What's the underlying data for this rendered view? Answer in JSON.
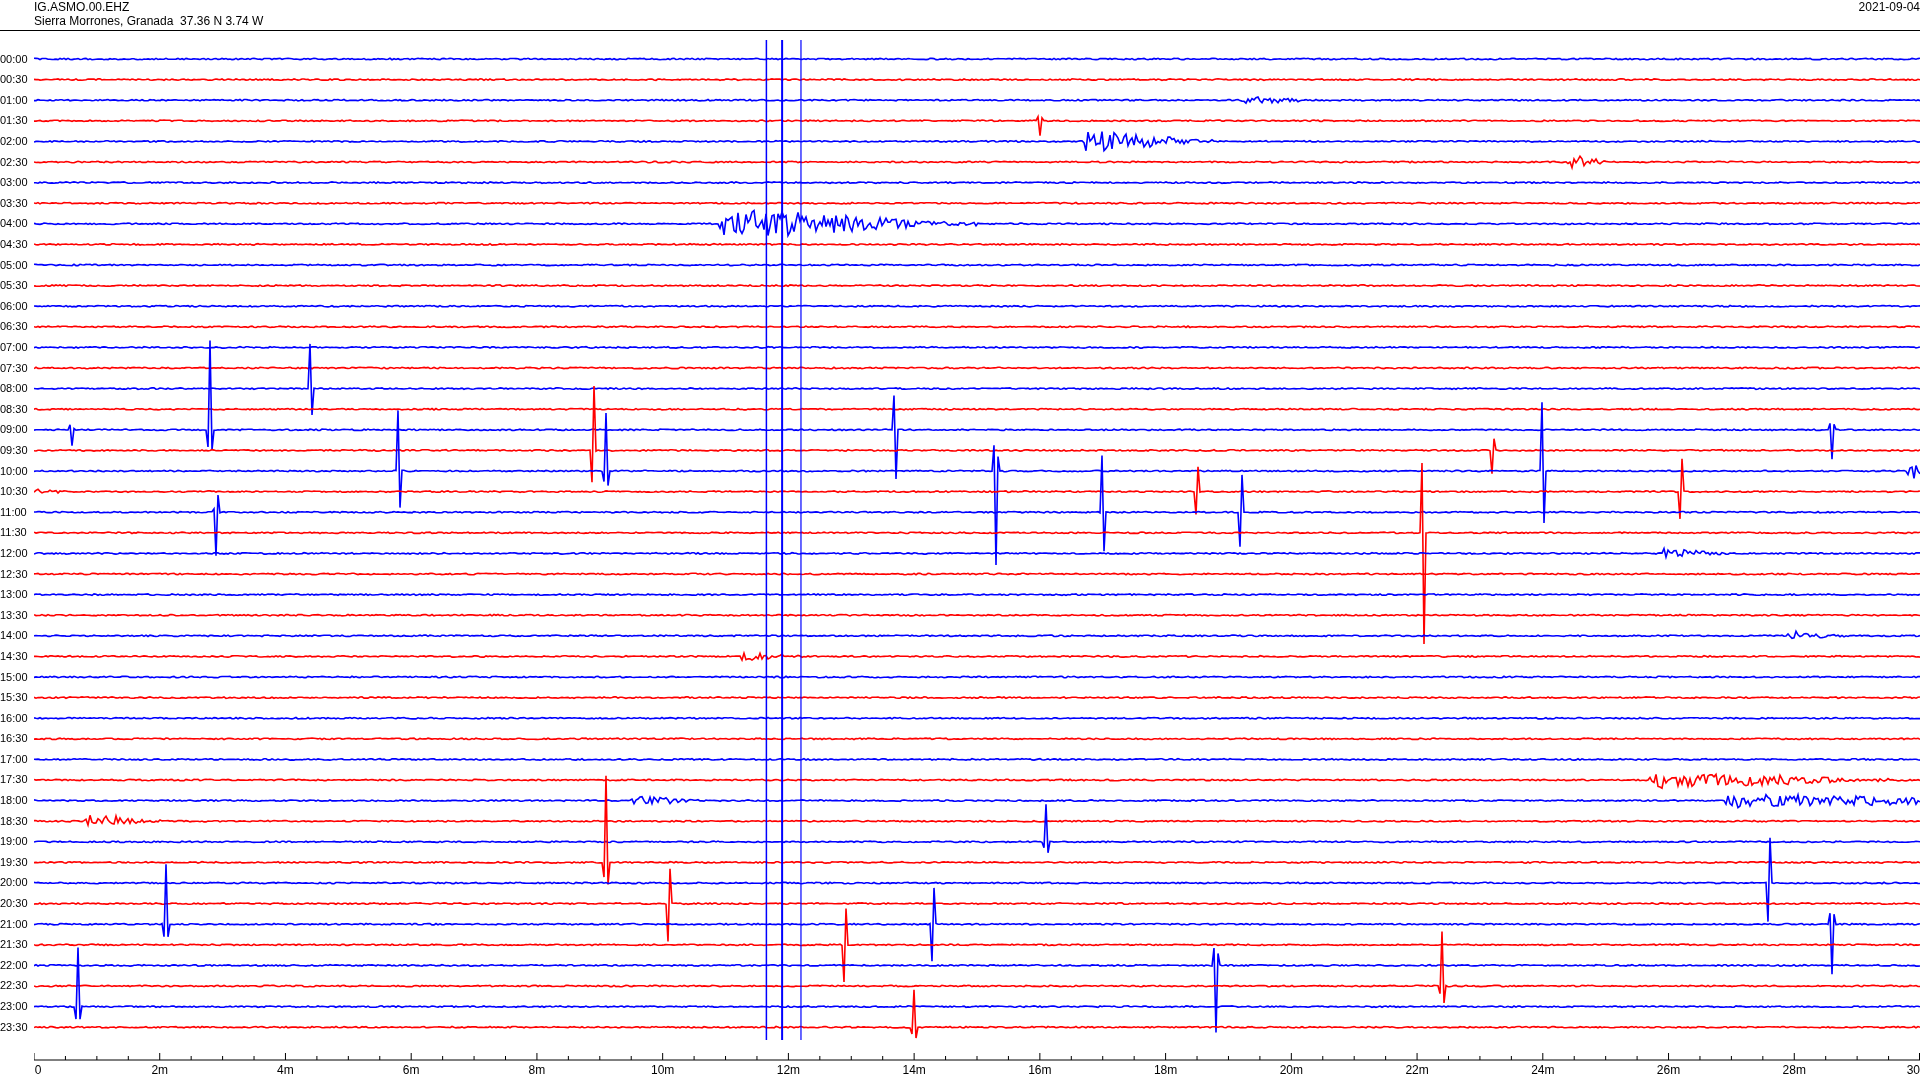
{
  "header": {
    "station": "IG.ASMO.00.EHZ",
    "location": "Sierra Morrones, Granada  37.36 N 3.74 W",
    "date": "2021-09-04"
  },
  "rows": [
    {
      "label": "00:00",
      "color": "#0000ff"
    },
    {
      "label": "00:30",
      "color": "#ff0000"
    },
    {
      "label": "01:00",
      "color": "#0000ff"
    },
    {
      "label": "01:30",
      "color": "#ff0000"
    },
    {
      "label": "02:00",
      "color": "#0000ff"
    },
    {
      "label": "02:30",
      "color": "#ff0000"
    },
    {
      "label": "03:00",
      "color": "#0000ff"
    },
    {
      "label": "03:30",
      "color": "#ff0000"
    },
    {
      "label": "04:00",
      "color": "#0000ff"
    },
    {
      "label": "04:30",
      "color": "#ff0000"
    },
    {
      "label": "05:00",
      "color": "#0000ff"
    },
    {
      "label": "05:30",
      "color": "#ff0000"
    },
    {
      "label": "06:00",
      "color": "#0000ff"
    },
    {
      "label": "06:30",
      "color": "#ff0000"
    },
    {
      "label": "07:00",
      "color": "#0000ff"
    },
    {
      "label": "07:30",
      "color": "#ff0000"
    },
    {
      "label": "08:00",
      "color": "#0000ff"
    },
    {
      "label": "08:30",
      "color": "#ff0000"
    },
    {
      "label": "09:00",
      "color": "#0000ff"
    },
    {
      "label": "09:30",
      "color": "#ff0000"
    },
    {
      "label": "10:00",
      "color": "#0000ff"
    },
    {
      "label": "10:30",
      "color": "#ff0000"
    },
    {
      "label": "11:00",
      "color": "#0000ff"
    },
    {
      "label": "11:30",
      "color": "#ff0000"
    },
    {
      "label": "12:00",
      "color": "#0000ff"
    },
    {
      "label": "12:30",
      "color": "#ff0000"
    },
    {
      "label": "13:00",
      "color": "#0000ff"
    },
    {
      "label": "13:30",
      "color": "#ff0000"
    },
    {
      "label": "14:00",
      "color": "#0000ff"
    },
    {
      "label": "14:30",
      "color": "#ff0000"
    },
    {
      "label": "15:00",
      "color": "#0000ff"
    },
    {
      "label": "15:30",
      "color": "#ff0000"
    },
    {
      "label": "16:00",
      "color": "#0000ff"
    },
    {
      "label": "16:30",
      "color": "#ff0000"
    },
    {
      "label": "17:00",
      "color": "#0000ff"
    },
    {
      "label": "17:30",
      "color": "#ff0000"
    },
    {
      "label": "18:00",
      "color": "#0000ff"
    },
    {
      "label": "18:30",
      "color": "#ff0000"
    },
    {
      "label": "19:00",
      "color": "#0000ff"
    },
    {
      "label": "19:30",
      "color": "#ff0000"
    },
    {
      "label": "20:00",
      "color": "#0000ff"
    },
    {
      "label": "20:30",
      "color": "#ff0000"
    },
    {
      "label": "21:00",
      "color": "#0000ff"
    },
    {
      "label": "21:30",
      "color": "#ff0000"
    },
    {
      "label": "22:00",
      "color": "#0000ff"
    },
    {
      "label": "22:30",
      "color": "#ff0000"
    },
    {
      "label": "23:00",
      "color": "#0000ff"
    },
    {
      "label": "23:30",
      "color": "#ff0000"
    }
  ],
  "time_axis": {
    "labels": [
      "0",
      "2m",
      "4m",
      "6m",
      "8m",
      "10m",
      "12m",
      "14m",
      "16m",
      "18m",
      "20m",
      "22m",
      "24m",
      "26m",
      "28m",
      "30"
    ]
  }
}
